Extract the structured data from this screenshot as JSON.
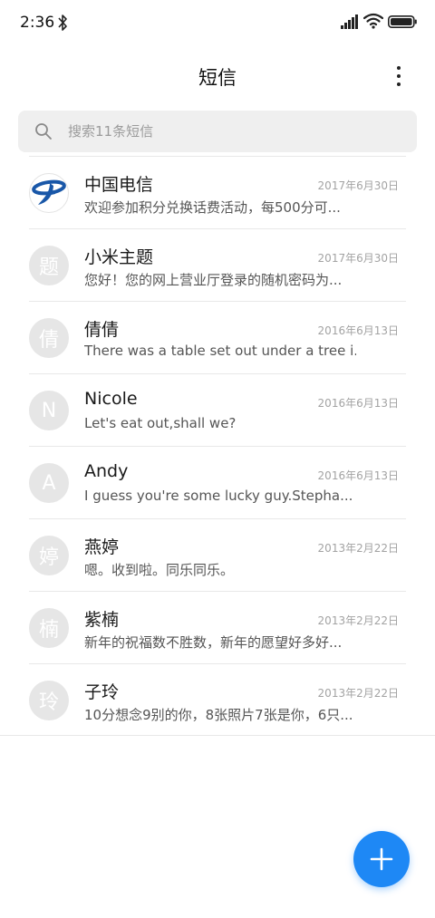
{
  "status_bar": {
    "time": "2:36"
  },
  "header": {
    "title": "短信"
  },
  "search": {
    "placeholder": "搜索11条短信"
  },
  "colors": {
    "accent": "#1e88f5",
    "avatar_bg": "#e6e6e6",
    "telecom_blue": "#1957a8"
  },
  "conversations": [
    {
      "avatar": "",
      "avatar_icon": "china-telecom-logo-icon",
      "sender": "中国电信",
      "date": "2017年6月30日",
      "preview": "欢迎参加积分兑换话费活动，每500分可..."
    },
    {
      "avatar": "题",
      "sender": "小米主题",
      "date": "2017年6月30日",
      "preview": "您好！您的网上营业厅登录的随机密码为..."
    },
    {
      "avatar": "倩",
      "sender": "倩倩",
      "date": "2016年6月13日",
      "preview": "There was a table set out under a tree i..."
    },
    {
      "avatar": "N",
      "sender": "Nicole",
      "date": "2016年6月13日",
      "preview": "Let's eat out,shall we?"
    },
    {
      "avatar": "A",
      "sender": "Andy",
      "date": "2016年6月13日",
      "preview": "I guess you're some lucky guy.Stepha..."
    },
    {
      "avatar": "婷",
      "sender": "燕婷",
      "date": "2013年2月22日",
      "preview": "嗯。收到啦。同乐同乐。"
    },
    {
      "avatar": "楠",
      "sender": "紫楠",
      "date": "2013年2月22日",
      "preview": "新年的祝福数不胜数，新年的愿望好多好..."
    },
    {
      "avatar": "玲",
      "sender": "子玲",
      "date": "2013年2月22日",
      "preview": "10分想念9别的你，8张照片7张是你，6只..."
    }
  ],
  "fab": {
    "icon": "plus-icon"
  }
}
